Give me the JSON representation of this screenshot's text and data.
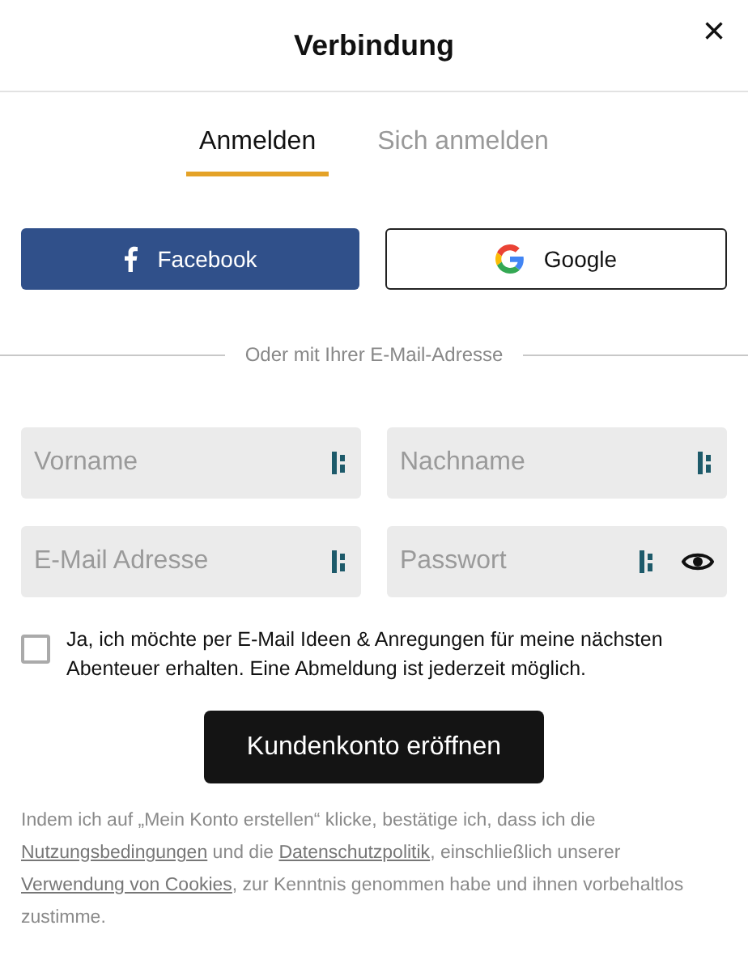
{
  "dialog": {
    "title": "Verbindung",
    "close": "×"
  },
  "tabs": [
    {
      "label": "Anmelden",
      "selected": true
    },
    {
      "label": "Sich anmelden",
      "selected": false
    }
  ],
  "social_buttons": [
    {
      "kind": "facebook",
      "label": "Facebook"
    },
    {
      "kind": "google",
      "label": "Google"
    }
  ],
  "divider_text": "Oder mit Ihrer E-Mail-Adresse",
  "fields": [
    {
      "kind": "text",
      "placeholder": "Vorname"
    },
    {
      "kind": "text",
      "placeholder": "Nachname"
    },
    {
      "kind": "text",
      "placeholder": "E-Mail Adresse"
    },
    {
      "kind": "password",
      "placeholder": "Passwort"
    }
  ],
  "newsletter": {
    "checked": false,
    "label": "Ja, ich möchte per E-Mail Ideen & Anregungen für meine nächsten Abenteuer erhalten. Eine Abmeldung ist jederzeit möglich."
  },
  "submit": "Kundenkonto eröffnen",
  "legal": [
    {
      "kind": "text",
      "text": "Indem ich auf „Mein Konto erstellen“ klicke, bestätige ich, dass ich die "
    },
    {
      "kind": "link",
      "text": "Nutzungsbedingungen"
    },
    {
      "kind": "text",
      "text": " und die "
    },
    {
      "kind": "link",
      "text": "Datenschutzpolitik"
    },
    {
      "kind": "text",
      "text": ", einschließlich unserer "
    },
    {
      "kind": "link",
      "text": "Verwendung von Cookies"
    },
    {
      "kind": "text",
      "text": ", zur Kenntnis genommen habe und ihnen vorbehaltlos zustimme."
    }
  ]
}
